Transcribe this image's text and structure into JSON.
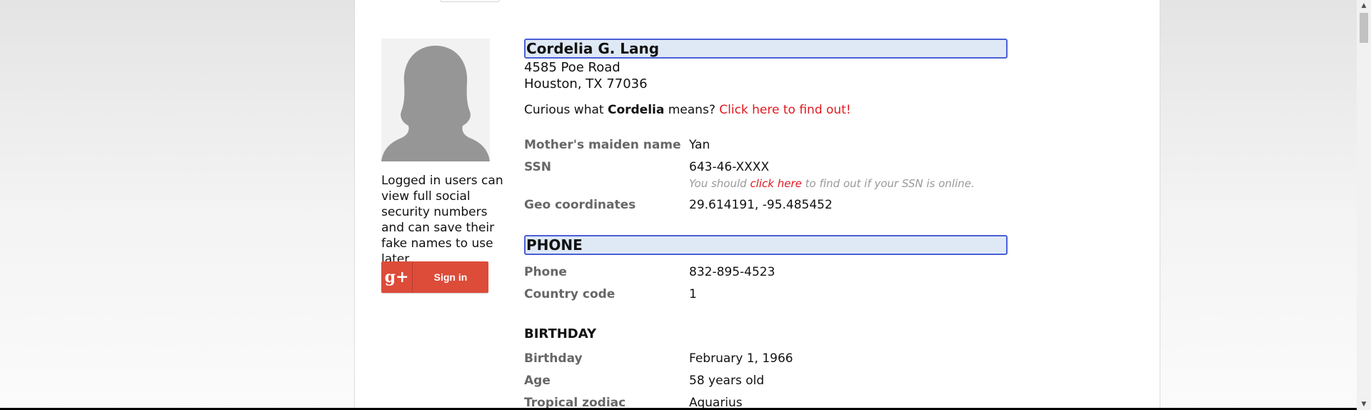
{
  "sidebar": {
    "note": "Logged in users can view full social security numbers and can save their fake names to use later.",
    "signin_label": "Sign in",
    "signin_logo": "g+"
  },
  "identity": {
    "name": "Cordelia G. Lang",
    "address_line1": "4585 Poe Road",
    "address_line2": "Houston, TX 77036",
    "curious_prefix": "Curious what ",
    "first_name": "Cordelia",
    "curious_suffix": " means? ",
    "curious_link": "Click here to find out!"
  },
  "details": {
    "maiden_label": "Mother's maiden name",
    "maiden_value": "Yan",
    "ssn_label": "SSN",
    "ssn_value": "643-46-XXXX",
    "ssn_note_prefix": "You should ",
    "ssn_note_link": "click here",
    "ssn_note_suffix": " to find out if your SSN is online.",
    "geo_label": "Geo coordinates",
    "geo_value": "29.614191, -95.485452"
  },
  "phone": {
    "title": "PHONE",
    "phone_label": "Phone",
    "phone_value": "832-895-4523",
    "cc_label": "Country code",
    "cc_value": "1"
  },
  "birthday": {
    "title": "BIRTHDAY",
    "birthday_label": "Birthday",
    "birthday_value": "February 1, 1966",
    "age_label": "Age",
    "age_value": "58 years old",
    "zodiac_label": "Tropical zodiac",
    "zodiac_value": "Aquarius"
  },
  "colors": {
    "link": "#e0191f",
    "heading_highlight": "#dfe9f6",
    "heading_border": "#4b5fd6",
    "google_red": "#dd4b39"
  },
  "icons": {
    "scroll_up": "triangle-up",
    "scroll_down": "triangle-down"
  }
}
